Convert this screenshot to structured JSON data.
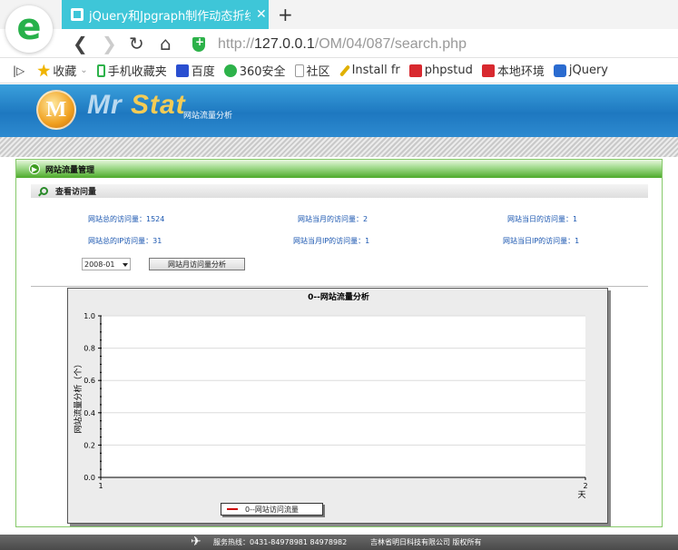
{
  "browser": {
    "tab_title": "jQuery和Jpgraph制作动态折线图",
    "url_prefix": "http://",
    "url_host": "127.0.0.1",
    "url_path": "/OM/04/087/search.php",
    "bookmarks": [
      {
        "label": "收藏",
        "icon": "star-icon",
        "color": "#f0b400"
      },
      {
        "label": "手机收藏夹",
        "icon": "phone-icon",
        "color": "#2db24a"
      },
      {
        "label": "百度",
        "icon": "baidu-paw-icon",
        "color": "#2a4fd0"
      },
      {
        "label": "360安全",
        "icon": "360-icon",
        "color": "#2db24a"
      },
      {
        "label": "社区",
        "icon": "page-icon",
        "color": "#bbbbbb"
      },
      {
        "label": "Install fr",
        "icon": "wand-icon",
        "color": "#e0b000"
      },
      {
        "label": "phpstud",
        "icon": "phpstudy-icon",
        "color": "#d8292f"
      },
      {
        "label": "本地环境",
        "icon": "local-env-icon",
        "color": "#d8292f"
      },
      {
        "label": "jQuery",
        "icon": "jquery-icon",
        "color": "#2a6bd0"
      }
    ]
  },
  "banner": {
    "brand_a": "Mr ",
    "brand_b": "Stat",
    "subtitle": "网站流量分析",
    "logo_letter": "M"
  },
  "panel": {
    "title": "网站流量管理",
    "subtitle": "查看访问量"
  },
  "stats": {
    "total_visits": "网站总的访问量：1524",
    "month_visits": "网站当月的访问量：2",
    "day_visits": "网站当日的访问量：1",
    "total_ip": "网站总的IP访问量：31",
    "month_ip": "网站当月IP的访问量：1",
    "day_ip": "网站当日IP的访问量：1"
  },
  "controls": {
    "month_select": "2008-01",
    "analyze_button": "网站月访问量分析"
  },
  "chart_data": {
    "type": "line",
    "title": "0--网站流量分析",
    "ylabel": "网站流量分析（个）",
    "xlabel": "天",
    "x_ticks": [
      "1",
      "2"
    ],
    "y_ticks": [
      "0.0",
      "0.2",
      "0.4",
      "0.6",
      "0.8",
      "1.0"
    ],
    "ylim": [
      0,
      1
    ],
    "xlim": [
      1,
      2
    ],
    "grid": true,
    "legend": "bottom",
    "series": [
      {
        "name": "0--网站访问流量",
        "color": "#cc0000",
        "values": []
      }
    ]
  },
  "footer": {
    "hotline": "服务热线：0431-84978981  84978982",
    "company": "吉林省明日科技有限公司  版权所有"
  }
}
